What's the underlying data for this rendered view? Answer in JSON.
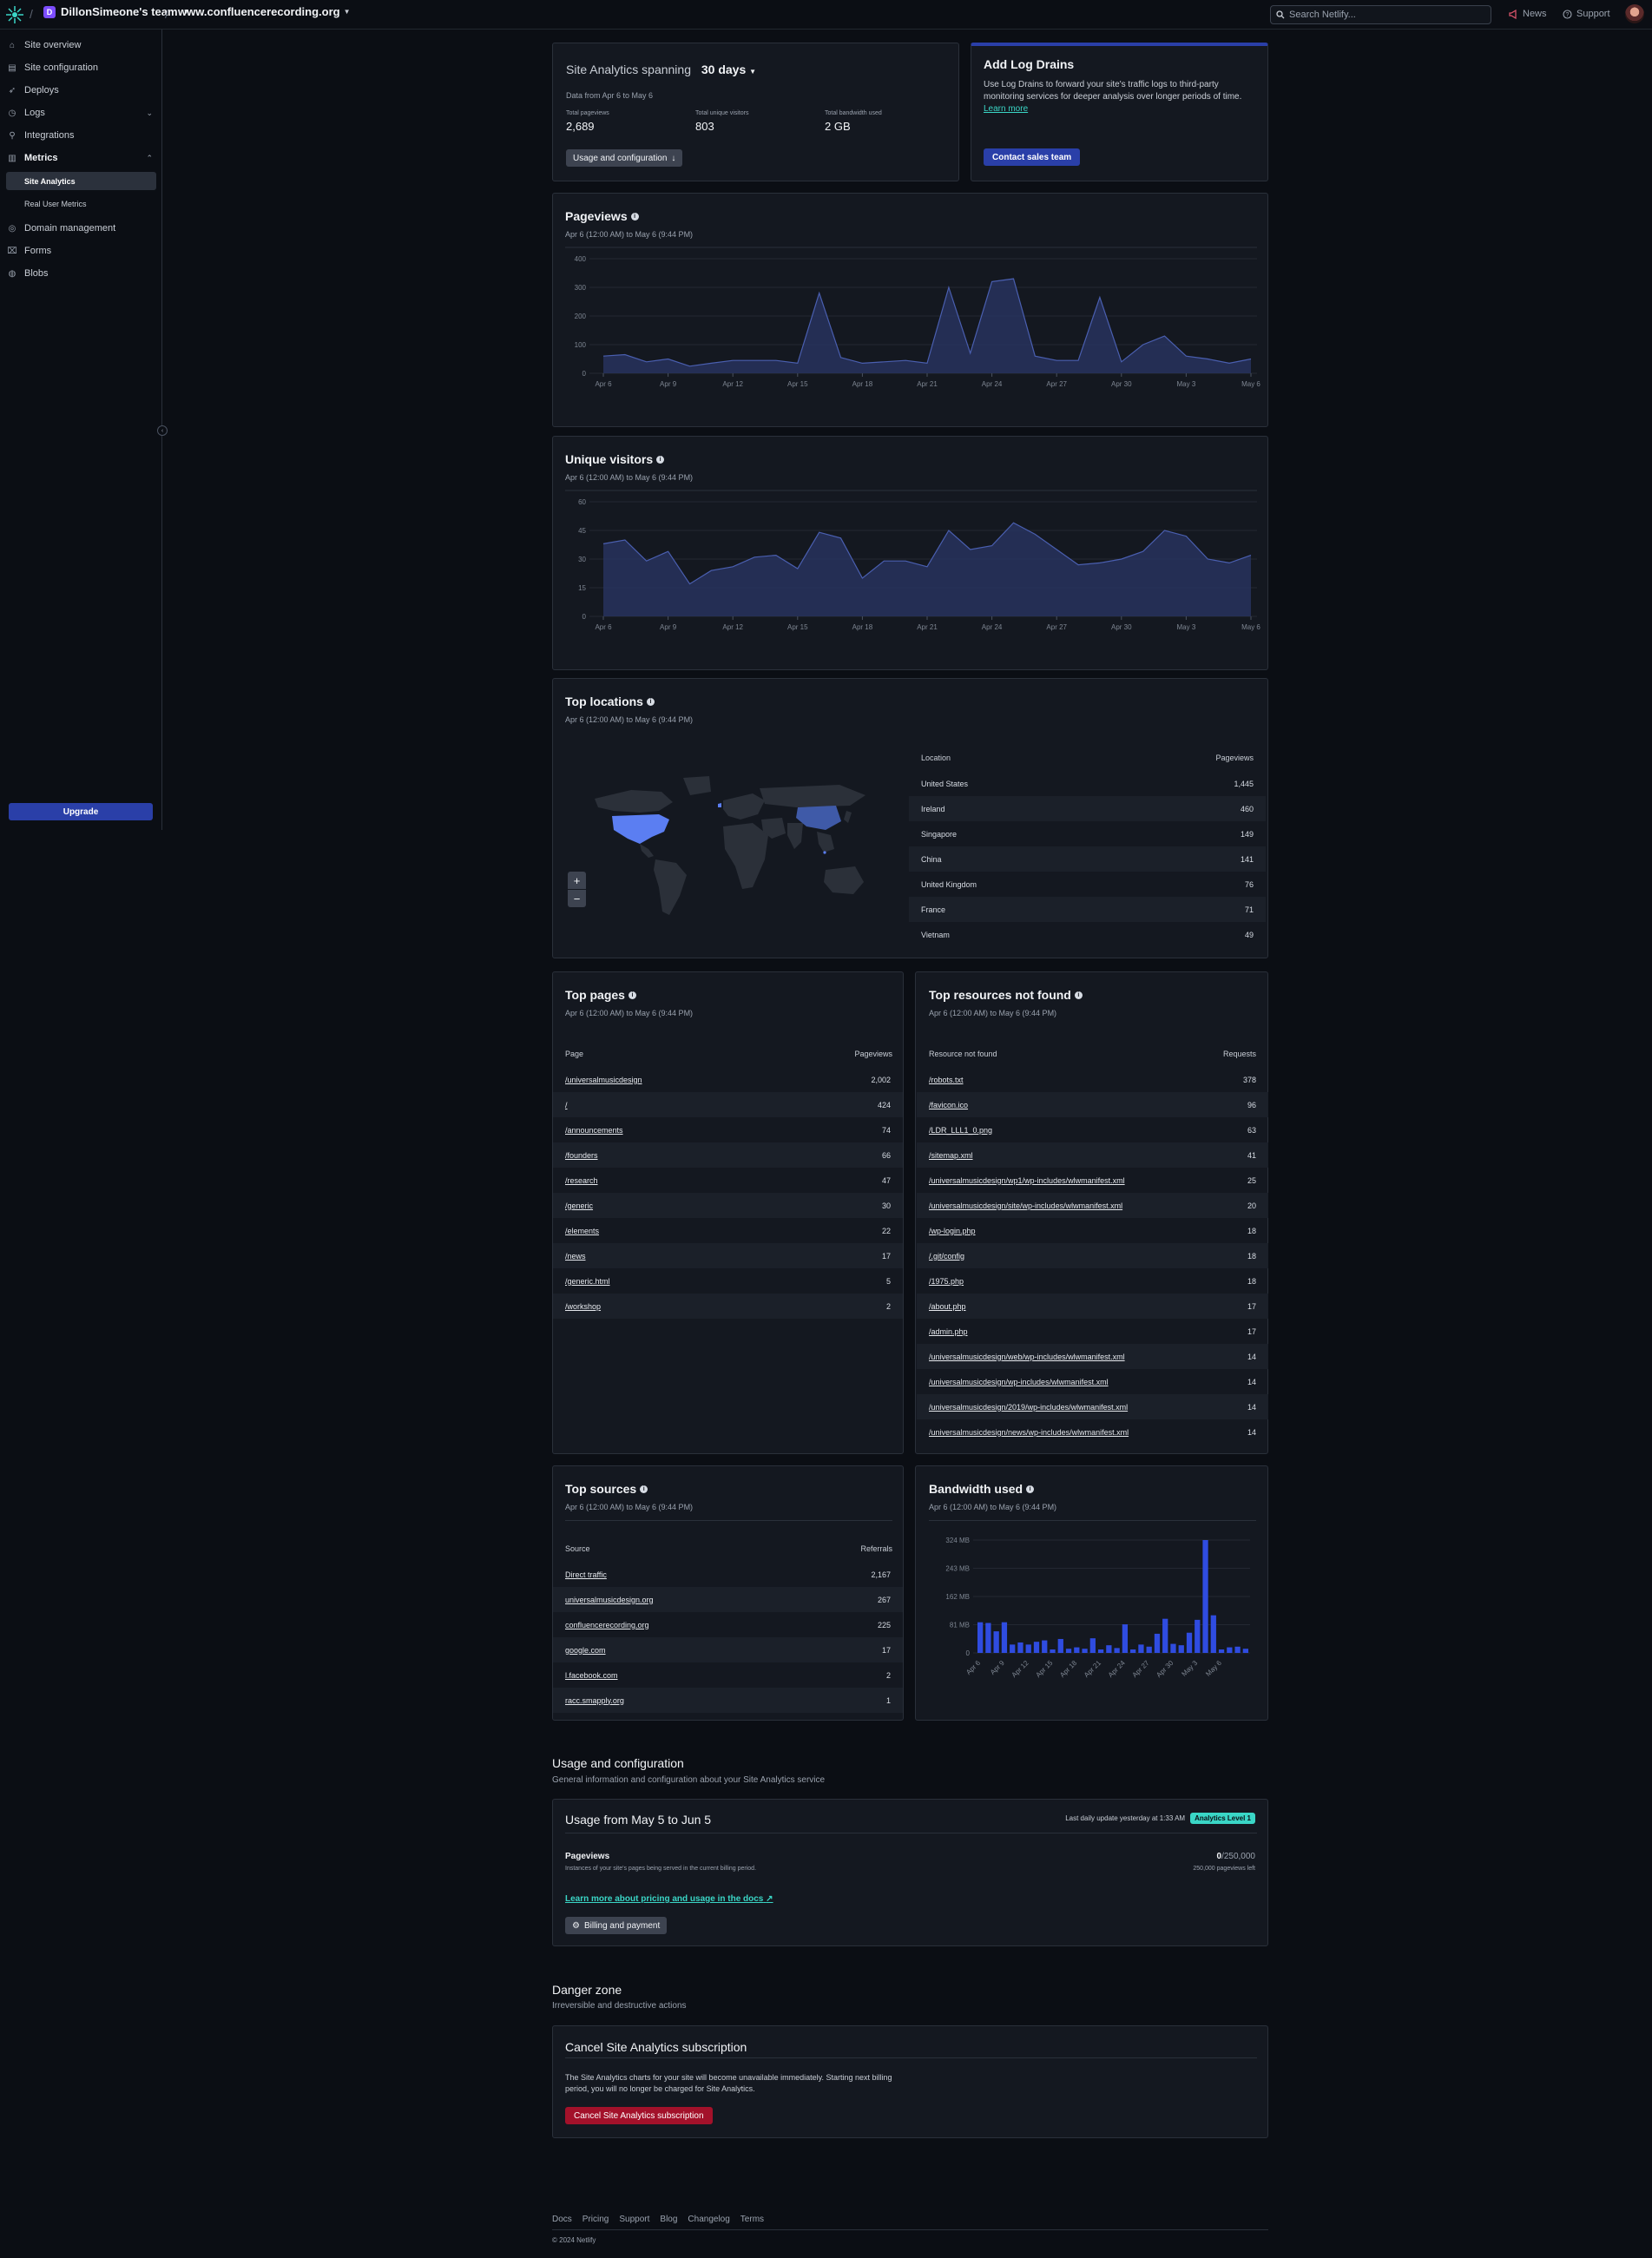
{
  "topbar": {
    "team": "DillonSimeone's team",
    "team_initial": "D",
    "site": "www.confluencerecording.org",
    "search_placeholder": "Search Netlify...",
    "news": "News",
    "support": "Support"
  },
  "sidebar": {
    "items": [
      {
        "label": "Site overview",
        "icon": "home-icon"
      },
      {
        "label": "Site configuration",
        "icon": "settings-icon"
      },
      {
        "label": "Deploys",
        "icon": "rocket-icon"
      },
      {
        "label": "Logs",
        "icon": "logs-icon"
      },
      {
        "label": "Integrations",
        "icon": "plug-icon"
      },
      {
        "label": "Metrics",
        "icon": "chart-icon"
      },
      {
        "label": "Domain management",
        "icon": "globe-icon"
      },
      {
        "label": "Forms",
        "icon": "form-icon"
      },
      {
        "label": "Blobs",
        "icon": "database-icon"
      }
    ],
    "sub_items": [
      "Site Analytics",
      "Real User Metrics"
    ],
    "upgrade": "Upgrade"
  },
  "summary": {
    "title": "Site Analytics spanning",
    "range": "30 days",
    "date": "Data from Apr 6 to May 6",
    "stats": [
      {
        "label": "Total pageviews",
        "value": "2,689"
      },
      {
        "label": "Total unique visitors",
        "value": "803"
      },
      {
        "label": "Total bandwidth used",
        "value": "2 GB"
      }
    ],
    "button": "Usage and configuration"
  },
  "log_drains": {
    "title": "Add Log Drains",
    "text": "Use Log Drains to forward your site's traffic logs to third-party monitoring services for deeper analysis over longer periods of time.",
    "link": "Learn more",
    "button": "Contact sales team"
  },
  "date_range": "Apr 6 (12:00 AM) to May 6 (9:44 PM)",
  "pageviews": {
    "title": "Pageviews"
  },
  "unique_visitors": {
    "title": "Unique visitors"
  },
  "x_ticks": [
    "Apr 6",
    "Apr 9",
    "Apr 12",
    "Apr 15",
    "Apr 18",
    "Apr 21",
    "Apr 24",
    "Apr 27",
    "Apr 30",
    "May 3",
    "May 6"
  ],
  "chart_data": [
    {
      "type": "area",
      "title": "Pageviews",
      "x": [
        "Apr 6",
        "Apr 7",
        "Apr 8",
        "Apr 9",
        "Apr 10",
        "Apr 11",
        "Apr 12",
        "Apr 13",
        "Apr 14",
        "Apr 15",
        "Apr 16",
        "Apr 17",
        "Apr 18",
        "Apr 19",
        "Apr 20",
        "Apr 21",
        "Apr 22",
        "Apr 23",
        "Apr 24",
        "Apr 25",
        "Apr 26",
        "Apr 27",
        "Apr 28",
        "Apr 29",
        "Apr 30",
        "May 1",
        "May 2",
        "May 3",
        "May 4",
        "May 5",
        "May 6"
      ],
      "values": [
        60,
        65,
        40,
        50,
        25,
        35,
        45,
        45,
        45,
        35,
        280,
        55,
        35,
        40,
        45,
        35,
        300,
        70,
        320,
        330,
        60,
        45,
        45,
        265,
        40,
        100,
        130,
        60,
        50,
        35,
        50
      ],
      "yticks": [
        0,
        100,
        200,
        300,
        400
      ],
      "ylim": [
        0,
        400
      ]
    },
    {
      "type": "area",
      "title": "Unique visitors",
      "x": [
        "Apr 6",
        "Apr 7",
        "Apr 8",
        "Apr 9",
        "Apr 10",
        "Apr 11",
        "Apr 12",
        "Apr 13",
        "Apr 14",
        "Apr 15",
        "Apr 16",
        "Apr 17",
        "Apr 18",
        "Apr 19",
        "Apr 20",
        "Apr 21",
        "Apr 22",
        "Apr 23",
        "Apr 24",
        "Apr 25",
        "Apr 26",
        "Apr 27",
        "Apr 28",
        "Apr 29",
        "Apr 30",
        "May 1",
        "May 2",
        "May 3",
        "May 4",
        "May 5",
        "May 6"
      ],
      "values": [
        38,
        40,
        29,
        34,
        17,
        24,
        26,
        31,
        32,
        25,
        44,
        41,
        20,
        29,
        29,
        26,
        45,
        35,
        37,
        49,
        43,
        35,
        27,
        28,
        30,
        34,
        45,
        42,
        30,
        28,
        32
      ],
      "yticks": [
        0,
        15,
        30,
        45,
        60
      ],
      "ylim": [
        0,
        60
      ]
    },
    {
      "type": "bar",
      "title": "Bandwidth used",
      "values": [
        88,
        86,
        62,
        88,
        24,
        30,
        24,
        32,
        36,
        10,
        40,
        12,
        16,
        12,
        42,
        10,
        22,
        14,
        82,
        10,
        24,
        18,
        55,
        98,
        26,
        22,
        58,
        95,
        324,
        108,
        10,
        16,
        18,
        12
      ],
      "yticks": [
        "0",
        "81 MB",
        "162 MB",
        "243 MB",
        "324 MB"
      ],
      "ylim": [
        0,
        324
      ],
      "x_ticks": [
        "Apr 6",
        "Apr 9",
        "Apr 12",
        "Apr 15",
        "Apr 18",
        "Apr 21",
        "Apr 24",
        "Apr 27",
        "Apr 30",
        "May 3",
        "May 6"
      ]
    }
  ],
  "top_locations": {
    "title": "Top locations",
    "col_location": "Location",
    "col_pageviews": "Pageviews",
    "rows": [
      {
        "name": "United States",
        "value": "1,445"
      },
      {
        "name": "Ireland",
        "value": "460"
      },
      {
        "name": "Singapore",
        "value": "149"
      },
      {
        "name": "China",
        "value": "141"
      },
      {
        "name": "United Kingdom",
        "value": "76"
      },
      {
        "name": "France",
        "value": "71"
      },
      {
        "name": "Vietnam",
        "value": "49"
      }
    ],
    "zoom_in": "+",
    "zoom_out": "−"
  },
  "top_pages": {
    "title": "Top pages",
    "col_page": "Page",
    "col_pageviews": "Pageviews",
    "rows": [
      {
        "name": "/universalmusicdesign",
        "value": "2,002"
      },
      {
        "name": "/",
        "value": "424"
      },
      {
        "name": "/announcements",
        "value": "74"
      },
      {
        "name": "/founders",
        "value": "66"
      },
      {
        "name": "/research",
        "value": "47"
      },
      {
        "name": "/generic",
        "value": "30"
      },
      {
        "name": "/elements",
        "value": "22"
      },
      {
        "name": "/news",
        "value": "17"
      },
      {
        "name": "/generic.html",
        "value": "5"
      },
      {
        "name": "/workshop",
        "value": "2"
      }
    ]
  },
  "not_found": {
    "title": "Top resources not found",
    "col_resource": "Resource not found",
    "col_requests": "Requests",
    "rows": [
      {
        "name": "/robots.txt",
        "value": "378"
      },
      {
        "name": "/favicon.ico",
        "value": "96"
      },
      {
        "name": "/LDR_LLL1_0.png",
        "value": "63"
      },
      {
        "name": "/sitemap.xml",
        "value": "41"
      },
      {
        "name": "/universalmusicdesign/wp1/wp-includes/wlwmanifest.xml",
        "value": "25"
      },
      {
        "name": "/universalmusicdesign/site/wp-includes/wlwmanifest.xml",
        "value": "20"
      },
      {
        "name": "/wp-login.php",
        "value": "18"
      },
      {
        "name": "/.git/config",
        "value": "18"
      },
      {
        "name": "/1975.php",
        "value": "18"
      },
      {
        "name": "/about.php",
        "value": "17"
      },
      {
        "name": "/admin.php",
        "value": "17"
      },
      {
        "name": "/universalmusicdesign/web/wp-includes/wlwmanifest.xml",
        "value": "14"
      },
      {
        "name": "/universalmusicdesign/wp-includes/wlwmanifest.xml",
        "value": "14"
      },
      {
        "name": "/universalmusicdesign/2019/wp-includes/wlwmanifest.xml",
        "value": "14"
      },
      {
        "name": "/universalmusicdesign/news/wp-includes/wlwmanifest.xml",
        "value": "14"
      }
    ]
  },
  "top_sources": {
    "title": "Top sources",
    "col_source": "Source",
    "col_referrals": "Referrals",
    "rows": [
      {
        "name": "Direct traffic",
        "value": "2,167"
      },
      {
        "name": "universalmusicdesign.org",
        "value": "267"
      },
      {
        "name": "confluencerecording.org",
        "value": "225"
      },
      {
        "name": "google.com",
        "value": "17"
      },
      {
        "name": "l.facebook.com",
        "value": "2"
      },
      {
        "name": "racc.smapply.org",
        "value": "1"
      }
    ]
  },
  "bandwidth": {
    "title": "Bandwidth used"
  },
  "usage": {
    "section_title": "Usage and configuration",
    "section_sub": "General information and configuration about your Site Analytics service",
    "card_title": "Usage from May 5 to Jun 5",
    "last_update": "Last daily update yesterday at 1:33 AM",
    "badge": "Analytics Level 1",
    "metric_title": "Pageviews",
    "metric_desc": "Instances of your site's pages being served in the current billing period.",
    "metric_used": "0",
    "metric_total": "/250,000",
    "metric_left": "250,000 pageviews left",
    "docs_link": "Learn more about pricing and usage in the docs",
    "billing_button": "Billing and payment"
  },
  "danger": {
    "section_title": "Danger zone",
    "section_sub": "Irreversible and destructive actions",
    "card_title": "Cancel Site Analytics subscription",
    "text": "The Site Analytics charts for your site will become unavailable immediately. Starting next billing period, you will no longer be charged for Site Analytics.",
    "button": "Cancel Site Analytics subscription"
  },
  "footer": {
    "links": [
      "Docs",
      "Pricing",
      "Support",
      "Blog",
      "Changelog",
      "Terms"
    ],
    "copyright": "© 2024 Netlify"
  },
  "colors": {
    "accent": "#2a3fa8",
    "chart_line": "#4a5fb0",
    "bar": "#2f4ce0",
    "map_highlight": "#5b7ef2",
    "danger": "#a3112a",
    "teal": "#3ad6c6"
  }
}
